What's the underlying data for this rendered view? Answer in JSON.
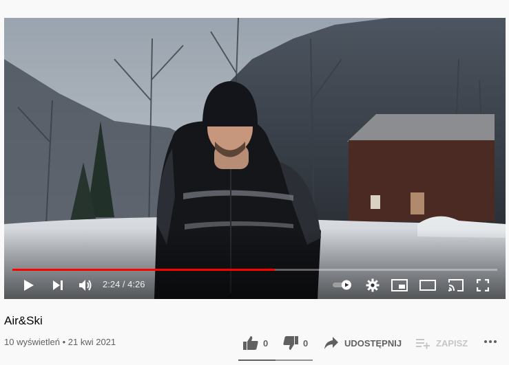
{
  "player": {
    "current_time": "2:24",
    "duration": "4:26",
    "time_separator": " / ",
    "progress": 0.541,
    "autoplay_enabled": true,
    "icons": [
      "play-icon",
      "next-icon",
      "volume-icon",
      "autoplay-toggle-icon",
      "settings-gear-icon",
      "miniplayer-icon",
      "theater-mode-icon",
      "cast-icon",
      "fullscreen-icon"
    ],
    "colors": {
      "progress": "#ff0000",
      "control_icons": "#ffffff"
    }
  },
  "video": {
    "title": "Air&Ski",
    "views": "10 wyświetleń",
    "separator": "•",
    "date": "21 kwi 2021"
  },
  "actions": {
    "likes": "0",
    "dislikes": "0",
    "share_label": "UDOSTĘPNIJ",
    "save_label": "ZAPISZ",
    "icons": [
      "thumbs-up-icon",
      "thumbs-down-icon",
      "share-arrow-icon",
      "add-to-playlist-icon",
      "more-options-icon"
    ]
  }
}
